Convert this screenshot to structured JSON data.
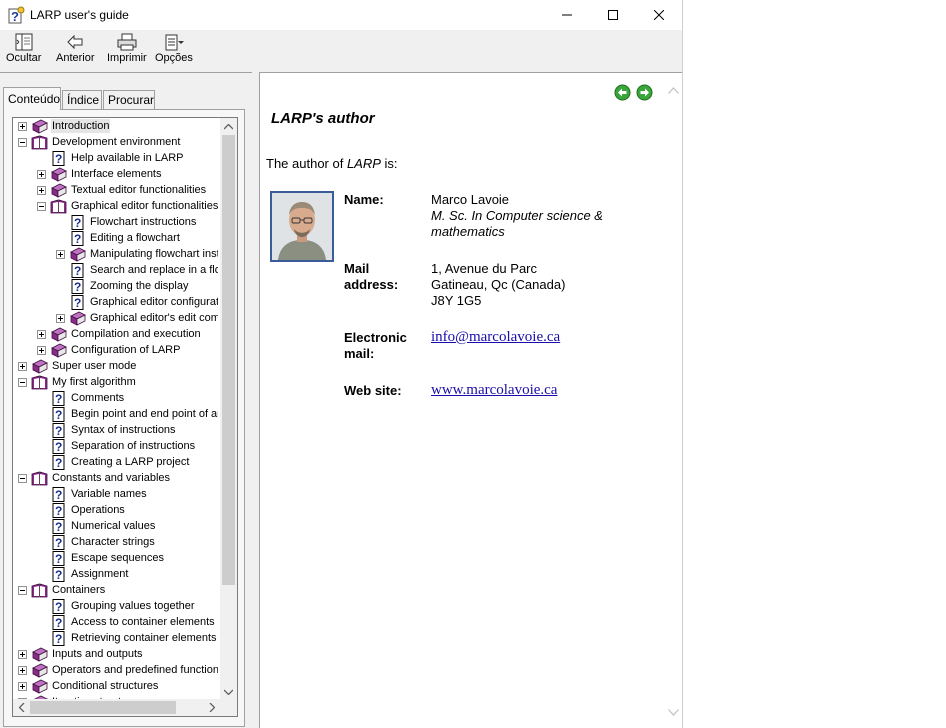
{
  "window": {
    "title": "LARP user's guide"
  },
  "toolbar": {
    "buttons": [
      {
        "label": "Ocultar",
        "icon": "hide-icon"
      },
      {
        "label": "Anterior",
        "icon": "back-arrow-icon"
      },
      {
        "label": "Imprimir",
        "icon": "printer-icon"
      },
      {
        "label": "Opções",
        "icon": "options-icon"
      }
    ]
  },
  "tabs": [
    {
      "label": "Conteúdo",
      "active": true
    },
    {
      "label": "Índice",
      "active": false
    },
    {
      "label": "Procurar",
      "active": false
    }
  ],
  "tree": [
    {
      "label": "Introduction",
      "type": "book-closed",
      "expander": "plus",
      "level": 0,
      "selected": true
    },
    {
      "label": "Development environment",
      "type": "book-open",
      "expander": "minus",
      "level": 0
    },
    {
      "label": "Help available in LARP",
      "type": "page",
      "expander": "none",
      "level": 1
    },
    {
      "label": "Interface elements",
      "type": "book-closed",
      "expander": "plus",
      "level": 1
    },
    {
      "label": "Textual editor functionalities",
      "type": "book-closed",
      "expander": "plus",
      "level": 1
    },
    {
      "label": "Graphical editor functionalities",
      "type": "book-open",
      "expander": "minus",
      "level": 1
    },
    {
      "label": "Flowchart instructions",
      "type": "page",
      "expander": "none",
      "level": 2
    },
    {
      "label": "Editing a flowchart",
      "type": "page",
      "expander": "none",
      "level": 2
    },
    {
      "label": "Manipulating flowchart inst",
      "type": "book-closed",
      "expander": "plus",
      "level": 2
    },
    {
      "label": "Search and replace in a flo",
      "type": "page",
      "expander": "none",
      "level": 2
    },
    {
      "label": "Zooming the display",
      "type": "page",
      "expander": "none",
      "level": 2
    },
    {
      "label": "Graphical editor configurati",
      "type": "page",
      "expander": "none",
      "level": 2
    },
    {
      "label": "Graphical editor's edit comi",
      "type": "book-closed",
      "expander": "plus",
      "level": 2
    },
    {
      "label": "Compilation and execution",
      "type": "book-closed",
      "expander": "plus",
      "level": 1
    },
    {
      "label": "Configuration of LARP",
      "type": "book-closed",
      "expander": "plus",
      "level": 1
    },
    {
      "label": "Super user mode",
      "type": "book-closed",
      "expander": "plus",
      "level": 0
    },
    {
      "label": "My first algorithm",
      "type": "book-open",
      "expander": "minus",
      "level": 0
    },
    {
      "label": "Comments",
      "type": "page",
      "expander": "none",
      "level": 1
    },
    {
      "label": "Begin point and end point of ar",
      "type": "page",
      "expander": "none",
      "level": 1
    },
    {
      "label": "Syntax of instructions",
      "type": "page",
      "expander": "none",
      "level": 1
    },
    {
      "label": "Separation of instructions",
      "type": "page",
      "expander": "none",
      "level": 1
    },
    {
      "label": "Creating a LARP project",
      "type": "page",
      "expander": "none",
      "level": 1
    },
    {
      "label": "Constants and variables",
      "type": "book-open",
      "expander": "minus",
      "level": 0
    },
    {
      "label": "Variable names",
      "type": "page",
      "expander": "none",
      "level": 1
    },
    {
      "label": "Operations",
      "type": "page",
      "expander": "none",
      "level": 1
    },
    {
      "label": "Numerical values",
      "type": "page",
      "expander": "none",
      "level": 1
    },
    {
      "label": "Character strings",
      "type": "page",
      "expander": "none",
      "level": 1
    },
    {
      "label": "Escape sequences",
      "type": "page",
      "expander": "none",
      "level": 1
    },
    {
      "label": "Assignment",
      "type": "page",
      "expander": "none",
      "level": 1
    },
    {
      "label": "Containers",
      "type": "book-open",
      "expander": "minus",
      "level": 0
    },
    {
      "label": "Grouping values together",
      "type": "page",
      "expander": "none",
      "level": 1
    },
    {
      "label": "Access to container elements",
      "type": "page",
      "expander": "none",
      "level": 1
    },
    {
      "label": "Retrieving container elements",
      "type": "page",
      "expander": "none",
      "level": 1
    },
    {
      "label": "Inputs and outputs",
      "type": "book-closed",
      "expander": "plus",
      "level": 0
    },
    {
      "label": "Operators and predefined functions",
      "type": "book-closed",
      "expander": "plus",
      "level": 0
    },
    {
      "label": "Conditional structures",
      "type": "book-closed",
      "expander": "plus",
      "level": 0
    },
    {
      "label": "Iterative structures",
      "type": "book-closed",
      "expander": "plus",
      "level": 0
    }
  ],
  "content": {
    "title": "LARP's author",
    "intro_before": "The author of ",
    "intro_em": "LARP",
    "intro_after": " is:",
    "name_label": "Name:",
    "name_value": "Marco Lavoie",
    "degree_line1": "M. Sc. In Computer science &",
    "degree_line2": "mathematics",
    "mail_label_1": "Mail",
    "mail_label_2": "address:",
    "address_line1": "1, Avenue du Parc",
    "address_line2": "Gatineau, Qc (Canada)",
    "address_line3": "J8Y 1G5",
    "email_label_1": "Electronic",
    "email_label_2": "mail:",
    "email_value": "info@marcolavoie.ca",
    "web_label": "Web site:",
    "web_value": "www.marcolavoie.ca"
  },
  "colors": {
    "book": "#8b2a8b",
    "link": "#1a0dab",
    "nav_arrow": "#3aa53a"
  }
}
